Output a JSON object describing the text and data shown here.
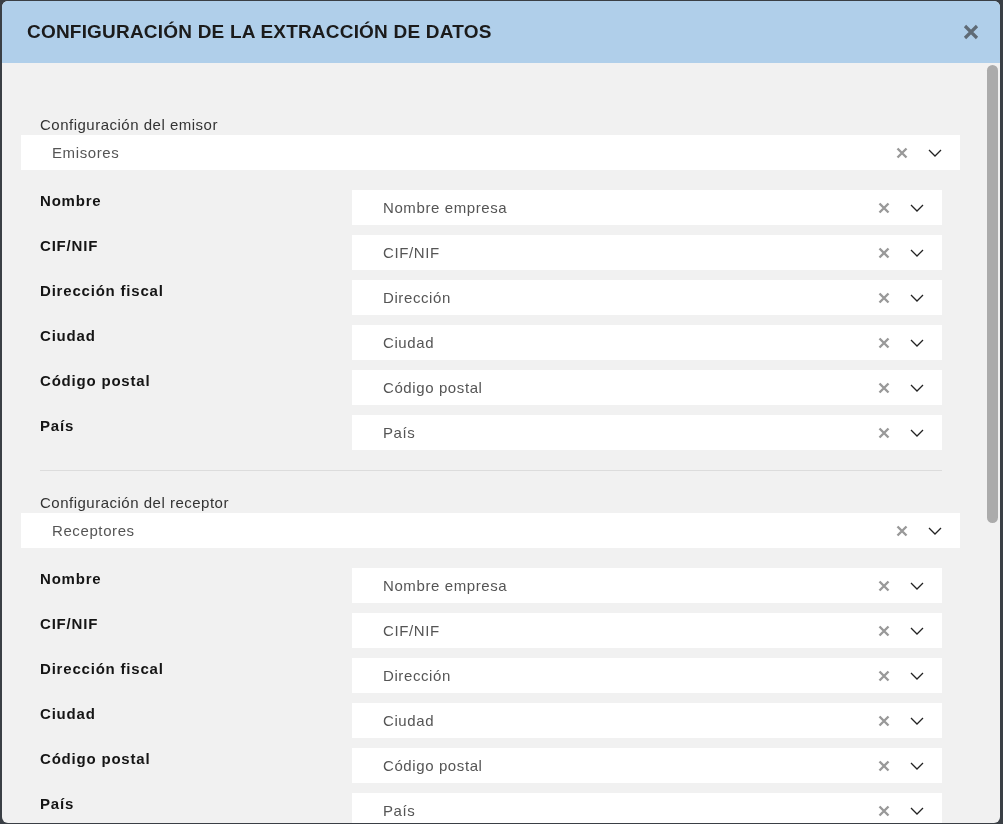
{
  "dialog": {
    "title": "CONFIGURACIÓN DE LA EXTRACCIÓN DE DATOS"
  },
  "sections": [
    {
      "label": "Configuración del emisor",
      "select": {
        "value": "Emisores"
      },
      "fields": [
        {
          "label": "Nombre",
          "value": "Nombre empresa"
        },
        {
          "label": "CIF/NIF",
          "value": "CIF/NIF"
        },
        {
          "label": "Dirección fiscal",
          "value": "Dirección"
        },
        {
          "label": "Ciudad",
          "value": "Ciudad"
        },
        {
          "label": "Código postal",
          "value": "Código postal"
        },
        {
          "label": "País",
          "value": "País"
        }
      ]
    },
    {
      "label": "Configuración del receptor",
      "select": {
        "value": "Receptores"
      },
      "fields": [
        {
          "label": "Nombre",
          "value": "Nombre empresa"
        },
        {
          "label": "CIF/NIF",
          "value": "CIF/NIF"
        },
        {
          "label": "Dirección fiscal",
          "value": "Dirección"
        },
        {
          "label": "Ciudad",
          "value": "Ciudad"
        },
        {
          "label": "Código postal",
          "value": "Código postal"
        },
        {
          "label": "País",
          "value": "País"
        }
      ]
    }
  ]
}
